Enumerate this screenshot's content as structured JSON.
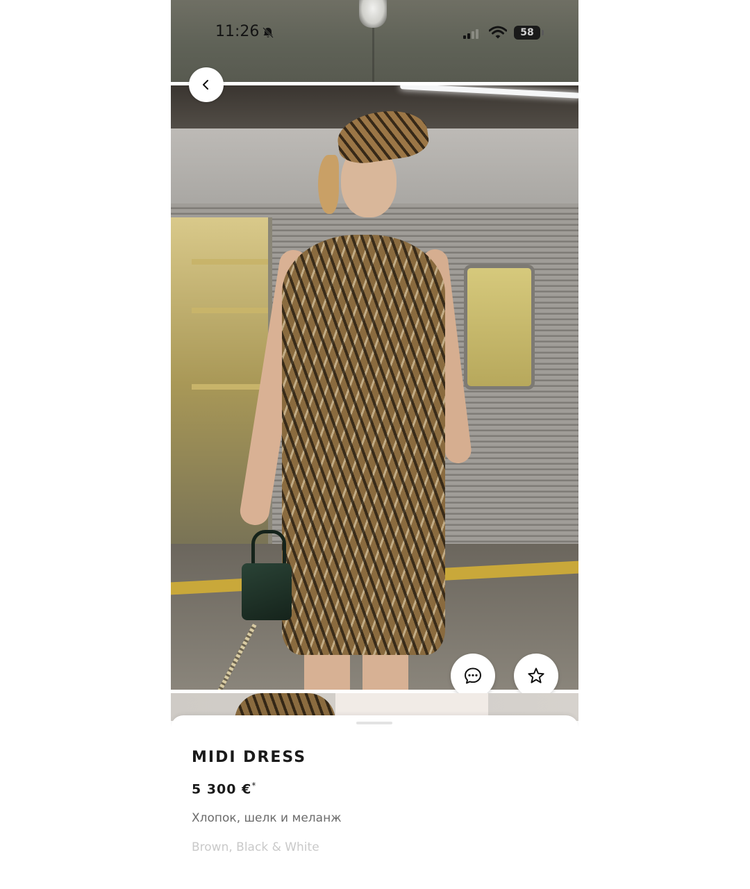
{
  "status_bar": {
    "time": "11:26",
    "battery": "58"
  },
  "icons": {
    "back": "chevron-left-icon",
    "chat": "chat-bubble-icon",
    "favorite": "star-outline-icon",
    "mute": "bell-slash-icon",
    "signal": "cellular-signal-icon",
    "wifi": "wifi-icon",
    "battery": "battery-icon"
  },
  "product": {
    "name": "MIDI DRESS",
    "price": "5 300 €",
    "price_note": "*",
    "material": "Хлопок, шелк и меланж",
    "colors": "Brown, Black & White"
  },
  "palette": {
    "background": "#ffffff",
    "text_primary": "#1a1a1a",
    "text_secondary": "#6b6b6b",
    "text_muted": "#c9c9c9"
  }
}
